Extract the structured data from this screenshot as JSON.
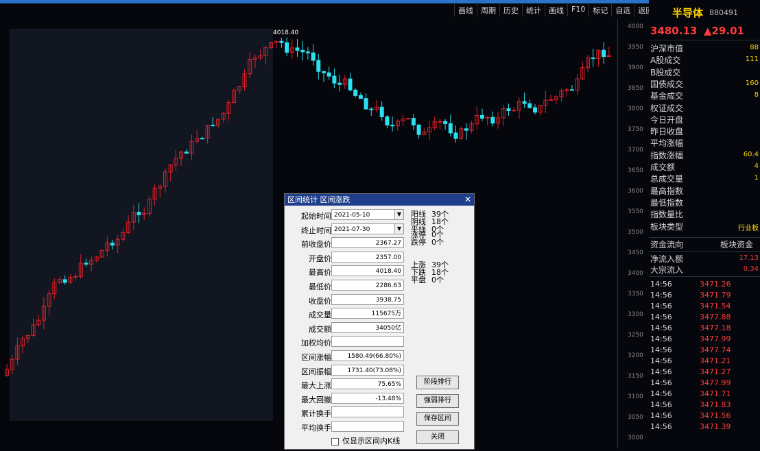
{
  "toolbar": [
    "画线",
    "周期",
    "历史",
    "统计",
    "画线",
    "F10",
    "标记",
    "自选",
    "返回"
  ],
  "chart": {
    "peak_label": "4018.40",
    "axis_ticks": [
      "4000",
      "3950",
      "3900",
      "3850",
      "3800",
      "3750",
      "3700",
      "3650",
      "3600",
      "3550",
      "3500",
      "3450",
      "3400",
      "3350",
      "3300",
      "3250",
      "3200",
      "3150",
      "3100",
      "3050",
      "3000"
    ]
  },
  "panel": {
    "title": "半导体",
    "code": "880491",
    "price": "3480.13",
    "change": "▲29.01",
    "rows": [
      {
        "label": "沪深市值",
        "value": "88"
      },
      {
        "label": "A股成交",
        "value": "111"
      },
      {
        "label": "B股成交",
        "value": ""
      },
      {
        "label": "国债成交",
        "value": "160"
      },
      {
        "label": "基金成交",
        "value": "8"
      },
      {
        "label": "权证成交",
        "value": ""
      },
      {
        "label": "今日开盘",
        "value": ""
      },
      {
        "label": "昨日收盘",
        "value": ""
      },
      {
        "label": "平均涨幅",
        "value": ""
      },
      {
        "label": "指数涨幅",
        "value": "60.4"
      },
      {
        "label": "成交额",
        "value": "4"
      },
      {
        "label": "总成交量",
        "value": "1"
      },
      {
        "label": "最高指数",
        "value": ""
      },
      {
        "label": "最低指数",
        "value": ""
      },
      {
        "label": "指数量比",
        "value": ""
      },
      {
        "label": "板块类型",
        "value": "行业板"
      }
    ],
    "flow_header": "资金流向",
    "flow_right": "板块资金",
    "flow_rows": [
      {
        "label": "净流入额",
        "value": "17.13"
      },
      {
        "label": "大宗流入",
        "value": "0.34"
      }
    ],
    "ticks": [
      {
        "time": "14:56",
        "price": "3471.26"
      },
      {
        "time": "14:56",
        "price": "3471.79"
      },
      {
        "time": "14:56",
        "price": "3471.54"
      },
      {
        "time": "14:56",
        "price": "3477.88"
      },
      {
        "time": "14:56",
        "price": "3477.18"
      },
      {
        "time": "14:56",
        "price": "3477.99"
      },
      {
        "time": "14:56",
        "price": "3477.74"
      },
      {
        "time": "14:56",
        "price": "3471.21"
      },
      {
        "time": "14:56",
        "price": "3471.27"
      },
      {
        "time": "14:56",
        "price": "3477.99"
      },
      {
        "time": "14:56",
        "price": "3471.71"
      },
      {
        "time": "14:56",
        "price": "3471.83"
      },
      {
        "time": "14:56",
        "price": "3471.56"
      },
      {
        "time": "14:56",
        "price": "3471.39"
      }
    ]
  },
  "dialog": {
    "title": "区间统计  区间涨跌",
    "fields": [
      {
        "label": "起始时间",
        "value": "2021-05-10",
        "combo": true
      },
      {
        "label": "终止时间",
        "value": "2021-07-30",
        "combo": true
      },
      {
        "label": "前收盘价",
        "value": "2367.27"
      },
      {
        "label": "开盘价",
        "value": "2357.00"
      },
      {
        "label": "最高价",
        "value": "4018.40"
      },
      {
        "label": "最低价",
        "value": "2286.63"
      },
      {
        "label": "收盘价",
        "value": "3938.75"
      },
      {
        "label": "成交量",
        "value": "115675万"
      },
      {
        "label": "成交额",
        "value": "34050亿"
      },
      {
        "label": "加权均价",
        "value": ""
      },
      {
        "label": "区间涨幅",
        "value": "1580.49(66.80%)"
      },
      {
        "label": "区间振幅",
        "value": "1731.40(73.08%)"
      },
      {
        "label": "最大上涨",
        "value": "75.65%"
      },
      {
        "label": "最大回撤",
        "value": "-13.48%"
      },
      {
        "label": "累计换手",
        "value": ""
      },
      {
        "label": "平均换手",
        "value": ""
      }
    ],
    "stats": [
      {
        "label": "阳线",
        "value": "39个"
      },
      {
        "label": "阴线",
        "value": "18个"
      },
      {
        "label": "平线",
        "value": "0个"
      },
      {
        "label": "涨停",
        "value": "0个"
      },
      {
        "label": "跌停",
        "value": "0个"
      },
      {
        "label": "上涨",
        "value": "39个"
      },
      {
        "label": "下跌",
        "value": "18个"
      },
      {
        "label": "平盘",
        "value": "0个"
      }
    ],
    "buttons": [
      "阶段排行",
      "强弱排行",
      "保存区间",
      "关闭"
    ],
    "checkbox": "仅显示区间内K线"
  },
  "colors": {
    "up": "#e0202a",
    "down": "#2be0f0",
    "accent": "#2a73c8",
    "title": "#ffd400"
  }
}
